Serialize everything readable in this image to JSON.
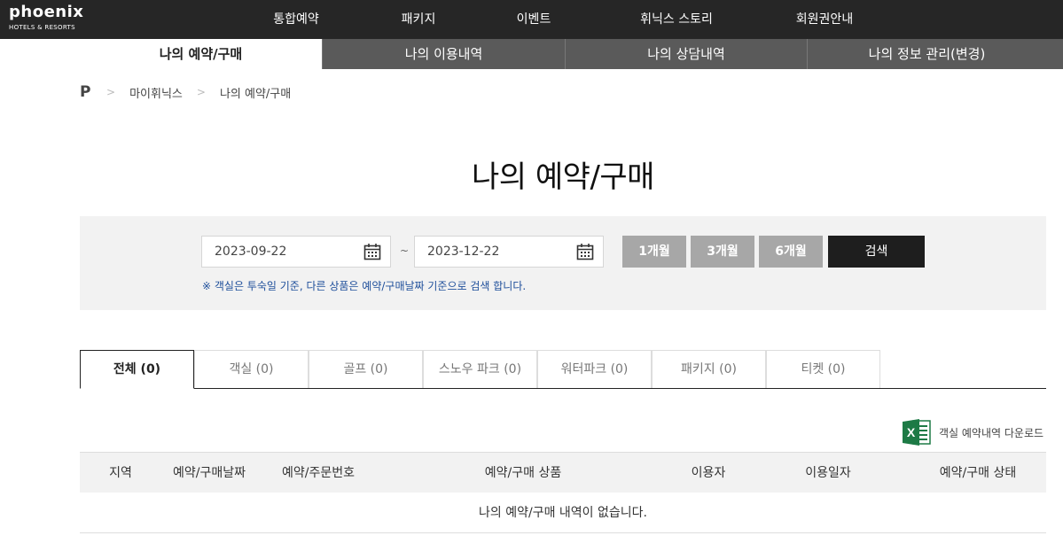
{
  "header": {
    "logo_main": "phoenix",
    "logo_sub": "HOTELS & RESORTS",
    "nav": [
      "통합예약",
      "패키지",
      "이벤트",
      "휘닉스 스토리",
      "회원권안내"
    ]
  },
  "subtabs": [
    "나의 예약/구매",
    "나의 이용내역",
    "나의 상담내역",
    "나의 정보 관리(변경)"
  ],
  "breadcrumb": {
    "home": "P",
    "items": [
      "마이휘닉스",
      "나의 예약/구매"
    ]
  },
  "page_title": "나의 예약/구매",
  "search": {
    "start_date": "2023-09-22",
    "end_date": "2023-12-22",
    "tilde": "~",
    "period_buttons": [
      "1개월",
      "3개월",
      "6개월"
    ],
    "search_label": "검색",
    "notice": "※ 객실은 투숙일 기준, 다른 상품은 예약/구매날짜 기준으로 검색 합니다."
  },
  "category_tabs": [
    "전체 (0)",
    "객실 (0)",
    "골프 (0)",
    "스노우 파크 (0)",
    "워터파크 (0)",
    "패키지 (0)",
    "티켓 (0)"
  ],
  "download_label": "객실 예약내역 다운로드",
  "table": {
    "headers": [
      "지역",
      "예약/구매날짜",
      "예약/주문번호",
      "예약/구매 상품",
      "이용자",
      "이용일자",
      "예약/구매 상태"
    ],
    "empty_message": "나의 예약/구매 내역이 없습니다."
  },
  "colors": {
    "topbar": "#262626",
    "tab_dark": "#5a5a5a",
    "period_button": "#a7a7a7",
    "search_button": "#1e1e1e",
    "notice": "#1f4f9b",
    "excel_green": "#1d7a45"
  }
}
